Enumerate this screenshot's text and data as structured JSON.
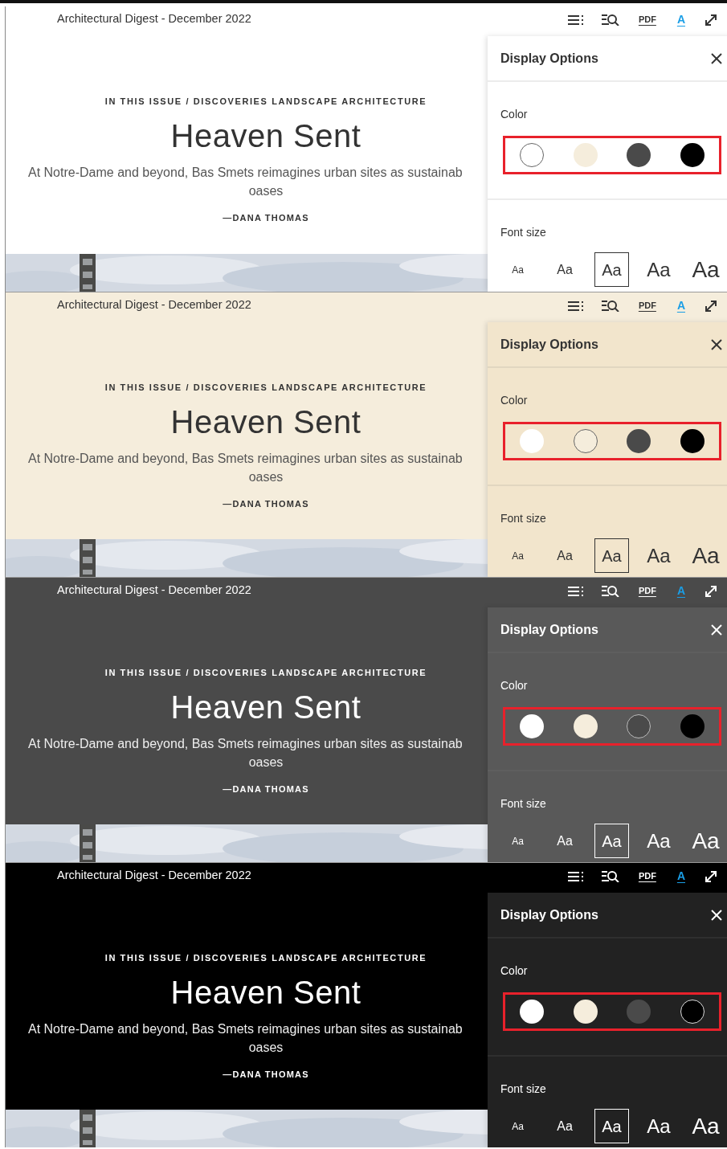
{
  "pages": [
    {
      "header_title": "Architectural Digest - December 2022",
      "toolbar": {
        "pdf_label": "PDF",
        "font_label": "A",
        "font_active": true
      },
      "article": {
        "kicker": "IN THIS ISSUE / DISCOVERIES LANDSCAPE ARCHITECTURE",
        "title": "Heaven Sent",
        "dek_lines": [
          "At Notre-Dame and beyond, Bas Smets reimagines urban sites as sustainab",
          "oases"
        ],
        "byline": "—DANA THOMAS"
      },
      "display_options": {
        "title": "Display Options",
        "color_label": "Color",
        "highlighted": true,
        "swatches": [
          {
            "color": "#ffffff",
            "selected": true
          },
          {
            "color": "#f5eddc",
            "selected": false
          },
          {
            "color": "#4a4a4a",
            "selected": false
          },
          {
            "color": "#000000",
            "selected": false
          }
        ],
        "font_size_label": "Font size",
        "font_sizes": [
          {
            "label": "Aa",
            "selected": false
          },
          {
            "label": "Aa",
            "selected": false
          },
          {
            "label": "Aa",
            "selected": true
          },
          {
            "label": "Aa",
            "selected": false
          },
          {
            "label": "Aa",
            "selected": false
          }
        ]
      }
    },
    {
      "header_title": "Architectural Digest - December 2022",
      "toolbar": {
        "pdf_label": "PDF",
        "font_label": "A",
        "font_active": true
      },
      "article": {
        "kicker": "IN THIS ISSUE / DISCOVERIES LANDSCAPE ARCHITECTURE",
        "title": "Heaven Sent",
        "dek_lines": [
          "At Notre-Dame and beyond, Bas Smets reimagines urban sites as sustainab",
          "oases"
        ],
        "byline": "—DANA THOMAS"
      },
      "display_options": {
        "title": "Display Options",
        "color_label": "Color",
        "highlighted": true,
        "swatches": [
          {
            "color": "#ffffff",
            "selected": false
          },
          {
            "color": "#f5eddc",
            "selected": true
          },
          {
            "color": "#4a4a4a",
            "selected": false
          },
          {
            "color": "#000000",
            "selected": false
          }
        ],
        "font_size_label": "Font size",
        "font_sizes": [
          {
            "label": "Aa",
            "selected": false
          },
          {
            "label": "Aa",
            "selected": false
          },
          {
            "label": "Aa",
            "selected": true
          },
          {
            "label": "Aa",
            "selected": false
          },
          {
            "label": "Aa",
            "selected": false
          }
        ]
      }
    },
    {
      "header_title": "Architectural Digest - December 2022",
      "toolbar": {
        "pdf_label": "PDF",
        "font_label": "A",
        "font_active": true
      },
      "article": {
        "kicker": "IN THIS ISSUE / DISCOVERIES LANDSCAPE ARCHITECTURE",
        "title": "Heaven Sent",
        "dek_lines": [
          "At Notre-Dame and beyond, Bas Smets reimagines urban sites as sustainab",
          "oases"
        ],
        "byline": "—DANA THOMAS"
      },
      "display_options": {
        "title": "Display Options",
        "color_label": "Color",
        "highlighted": true,
        "swatches": [
          {
            "color": "#ffffff",
            "selected": false
          },
          {
            "color": "#f5eddc",
            "selected": false
          },
          {
            "color": "#4a4a4a",
            "selected": true
          },
          {
            "color": "#000000",
            "selected": false
          }
        ],
        "font_size_label": "Font size",
        "font_sizes": [
          {
            "label": "Aa",
            "selected": false
          },
          {
            "label": "Aa",
            "selected": false
          },
          {
            "label": "Aa",
            "selected": true
          },
          {
            "label": "Aa",
            "selected": false
          },
          {
            "label": "Aa",
            "selected": false
          }
        ]
      }
    },
    {
      "header_title": "Architectural Digest - December 2022",
      "toolbar": {
        "pdf_label": "PDF",
        "font_label": "A",
        "font_active": true
      },
      "article": {
        "kicker": "IN THIS ISSUE / DISCOVERIES LANDSCAPE ARCHITECTURE",
        "title": "Heaven Sent",
        "dek_lines": [
          "At Notre-Dame and beyond, Bas Smets reimagines urban sites as sustainab",
          "oases"
        ],
        "byline": "—DANA THOMAS"
      },
      "display_options": {
        "title": "Display Options",
        "color_label": "Color",
        "highlighted": true,
        "swatches": [
          {
            "color": "#ffffff",
            "selected": false
          },
          {
            "color": "#f5eddc",
            "selected": false
          },
          {
            "color": "#4a4a4a",
            "selected": false
          },
          {
            "color": "#000000",
            "selected": true
          }
        ],
        "font_size_label": "Font size",
        "font_sizes": [
          {
            "label": "Aa",
            "selected": false
          },
          {
            "label": "Aa",
            "selected": false
          },
          {
            "label": "Aa",
            "selected": true
          },
          {
            "label": "Aa",
            "selected": false
          },
          {
            "label": "Aa",
            "selected": false
          }
        ]
      }
    }
  ]
}
